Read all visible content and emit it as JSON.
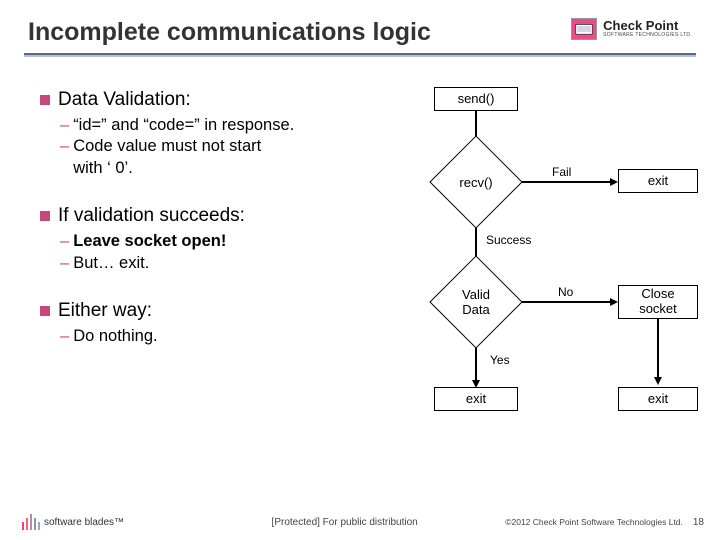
{
  "header": {
    "title": "Incomplete communications logic",
    "logo_main": "Check Point",
    "logo_sub": "SOFTWARE TECHNOLOGIES LTD."
  },
  "bullets": {
    "b1": {
      "head": "Data Validation:",
      "s1": "“id=” and “code=” in response.",
      "s2a": "Code value must not start",
      "s2b": "with ‘ 0’."
    },
    "b2": {
      "head": "If validation succeeds:",
      "s1": "Leave socket open!",
      "s2": "But… exit."
    },
    "b3": {
      "head": "Either way:",
      "s1": "Do nothing."
    }
  },
  "flow": {
    "send": "send()",
    "recv": "recv()",
    "success": "Success",
    "fail": "Fail",
    "valid": "Valid\nData",
    "yes": "Yes",
    "no": "No",
    "close": "Close\nsocket",
    "exit": "exit"
  },
  "footer": {
    "sw": "software blades™",
    "protected": "[Protected] For public distribution",
    "copyright": "©2012 Check Point Software Technologies Ltd.",
    "page": "18"
  },
  "chart_data": {
    "type": "flowchart",
    "nodes": [
      {
        "id": "send",
        "type": "process",
        "label": "send()"
      },
      {
        "id": "recv",
        "type": "decision",
        "label": "recv()"
      },
      {
        "id": "exit_fail",
        "type": "process",
        "label": "exit"
      },
      {
        "id": "valid",
        "type": "decision",
        "label": "Valid Data"
      },
      {
        "id": "close",
        "type": "process",
        "label": "Close socket"
      },
      {
        "id": "exit_yes",
        "type": "process",
        "label": "exit"
      },
      {
        "id": "exit_close",
        "type": "process",
        "label": "exit"
      }
    ],
    "edges": [
      {
        "from": "send",
        "to": "recv",
        "label": ""
      },
      {
        "from": "recv",
        "to": "exit_fail",
        "label": "Fail"
      },
      {
        "from": "recv",
        "to": "valid",
        "label": "Success"
      },
      {
        "from": "valid",
        "to": "close",
        "label": "No"
      },
      {
        "from": "valid",
        "to": "exit_yes",
        "label": "Yes"
      },
      {
        "from": "close",
        "to": "exit_close",
        "label": ""
      }
    ]
  }
}
